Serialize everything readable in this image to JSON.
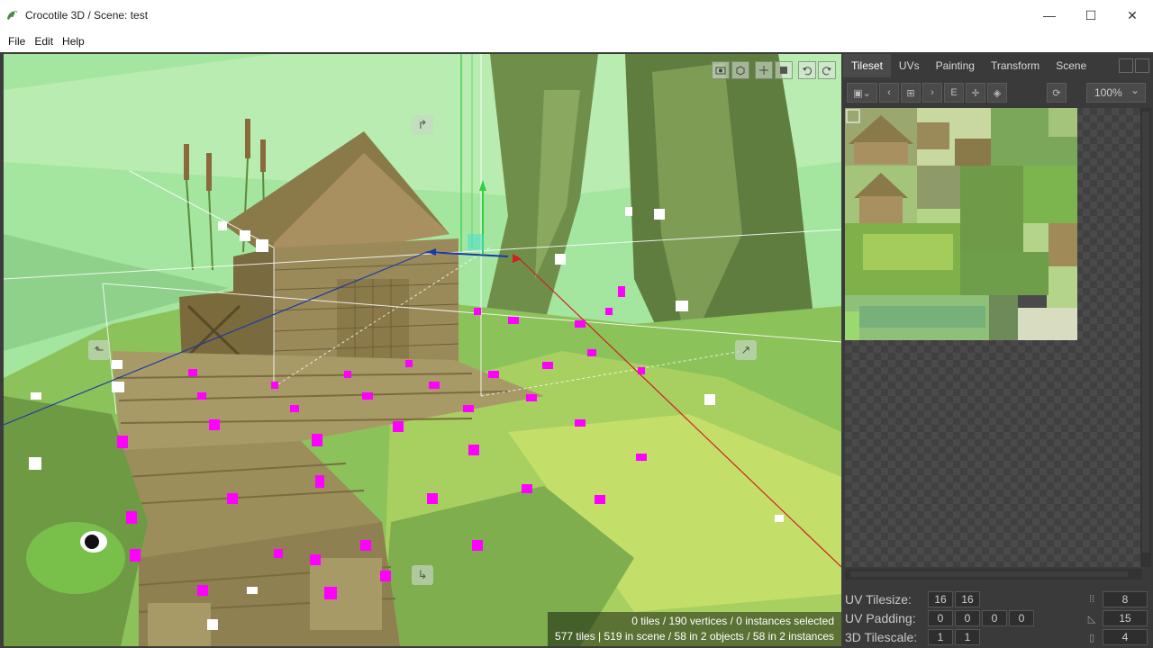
{
  "window": {
    "title": "Crocotile 3D / Scene: test",
    "minimize": "—",
    "maximize": "☐",
    "close": "✕"
  },
  "menu": [
    "File",
    "Edit",
    "Help"
  ],
  "viewport": {
    "status_line1": "0 tiles / 190 vertices / 0 instances selected",
    "status_line2": "577 tiles | 519 in scene / 58 in 2 objects / 58 in 2 instances",
    "toolbar_icons": [
      "camera-icon",
      "cube-icon",
      "gizmo-icon",
      "square-icon",
      "undo-icon",
      "redo-icon"
    ]
  },
  "panel": {
    "tabs": [
      "Tileset",
      "UVs",
      "Painting",
      "Transform",
      "Scene"
    ],
    "active_tab": "Tileset",
    "zoom": "100%",
    "uv_tilesize": {
      "label": "UV Tilesize:",
      "values": [
        "16",
        "16"
      ]
    },
    "uv_padding": {
      "label": "UV Padding:",
      "values": [
        "0",
        "0",
        "0",
        "0"
      ]
    },
    "tilescale_3d": {
      "label": "3D Tilescale:",
      "values": [
        "1",
        "1"
      ]
    },
    "right_values": [
      "8",
      "15",
      "4"
    ]
  },
  "colors": {
    "sky": "#9ae09a",
    "panel_bg": "#3a3a3a",
    "selection_magenta": "#ff00ff"
  }
}
